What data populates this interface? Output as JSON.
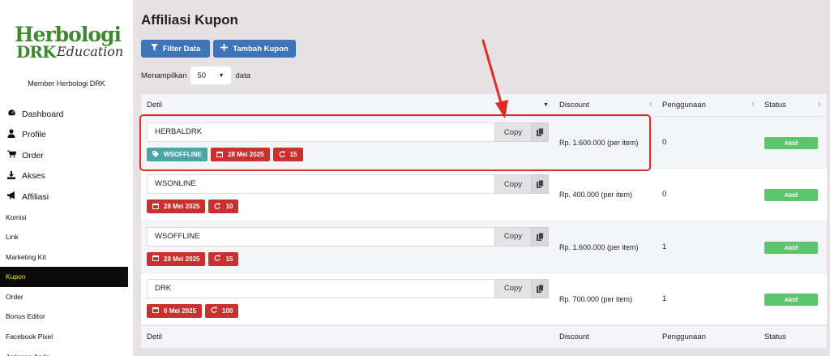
{
  "sidebar": {
    "logo": {
      "line1": "Herbologi",
      "line2": "DRK",
      "line3": "Education"
    },
    "member": "Member Herbologi DRK",
    "main_items": [
      {
        "label": "Dashboard",
        "icon": "dashboard-icon"
      },
      {
        "label": "Profile",
        "icon": "user-icon"
      },
      {
        "label": "Order",
        "icon": "cart-icon"
      },
      {
        "label": "Akses",
        "icon": "download-icon"
      },
      {
        "label": "Affiliasi",
        "icon": "megaphone-icon"
      }
    ],
    "sub_items": [
      {
        "label": "Komisi",
        "active": false
      },
      {
        "label": "Link",
        "active": false
      },
      {
        "label": "Marketing Kit",
        "active": false
      },
      {
        "label": "Kupon",
        "active": true
      },
      {
        "label": "Order",
        "active": false
      },
      {
        "label": "Bonus Editor",
        "active": false
      },
      {
        "label": "Facebook Pixel",
        "active": false
      },
      {
        "label": "Jaringan Anda",
        "active": false
      }
    ],
    "active_color": "#f2e21f"
  },
  "page": {
    "title": "Affiliasi Kupon",
    "filter_label": "Filter Data",
    "add_label": "Tambah Kupon",
    "show_prefix": "Menampilkan",
    "show_value": "50",
    "show_suffix": "data",
    "accent": "#3f74bb"
  },
  "table": {
    "columns": {
      "detil": "Detil",
      "discount": "Discount",
      "usage": "Penggunaan",
      "status": "Status"
    },
    "copy_label": "Copy",
    "rows": [
      {
        "code": "HERBALDRK",
        "tag": "WSOFFLINE",
        "date": "28 Mei 2025",
        "limit": "15",
        "discount": "Rp. 1.600.000 (per item)",
        "usage": "0",
        "status": "Aktif"
      },
      {
        "code": "WSONLINE",
        "date": "28 Mei 2025",
        "limit": "10",
        "discount": "Rp. 400.000 (per item)",
        "usage": "0",
        "status": "Aktif"
      },
      {
        "code": "WSOFFLINE",
        "date": "28 Mei 2025",
        "limit": "15",
        "discount": "Rp. 1.600.000 (per item)",
        "usage": "1",
        "status": "Aktif"
      },
      {
        "code": "DRK",
        "date": "6 Mei 2025",
        "limit": "100",
        "discount": "Rp. 700.000 (per item)",
        "usage": "1",
        "status": "Aktif"
      }
    ],
    "status_color": "#5cc56c",
    "badge_red": "#c8312d",
    "badge_teal": "#48a6a6"
  },
  "annotation": {
    "color": "#e02b24"
  }
}
